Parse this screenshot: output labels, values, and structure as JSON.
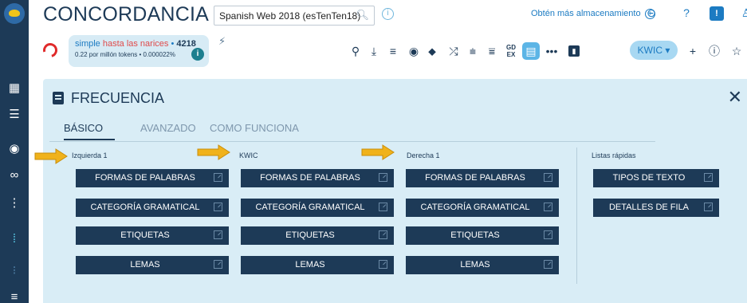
{
  "app": {
    "title": "CONCORDANCIA",
    "corpus": "Spanish Web 2018 (esTenTen18)",
    "storage_link": "Obtén más almacenamiento",
    "kwic_button": "KWIC ▾"
  },
  "query": {
    "term": "simple",
    "rest": " hasta las narices",
    "count": "4218",
    "stats": "0.22 por millón tokens • 0.000022%"
  },
  "panel": {
    "title": "FRECUENCIA",
    "tabs": [
      "BÁSICO",
      "AVANZADO",
      "COMO FUNCIONA"
    ],
    "active_tab": "BÁSICO",
    "columns": [
      {
        "label": "Izquierda 1",
        "buttons": [
          "FORMAS DE PALABRAS",
          "CATEGORÍA GRAMATICAL",
          "ETIQUETAS",
          "LEMAS"
        ]
      },
      {
        "label": "KWIC",
        "buttons": [
          "FORMAS DE PALABRAS",
          "CATEGORÍA GRAMATICAL",
          "ETIQUETAS",
          "LEMAS"
        ]
      },
      {
        "label": "Derecha 1",
        "buttons": [
          "FORMAS DE PALABRAS",
          "CATEGORÍA GRAMATICAL",
          "ETIQUETAS",
          "LEMAS"
        ]
      },
      {
        "label": "Listas rápidas",
        "buttons": [
          "TIPOS DE TEXTO",
          "DETALLES DE FILA"
        ]
      }
    ]
  },
  "toolbar_icons": [
    "search-icon",
    "download-icon",
    "list-icon",
    "eye-icon",
    "sample-icon",
    "shuffle-icon",
    "sort-icon",
    "filter-icon",
    "gdex-icon",
    "frequency-icon",
    "dots-icon",
    "chart-icon"
  ],
  "colors": {
    "sidebar": "#1d3a57",
    "button": "#1d3a57",
    "panel": "#d9edf6",
    "accent": "#1c7bc2",
    "arrow": "#f0b21b",
    "query_red": "#e02a2a"
  }
}
